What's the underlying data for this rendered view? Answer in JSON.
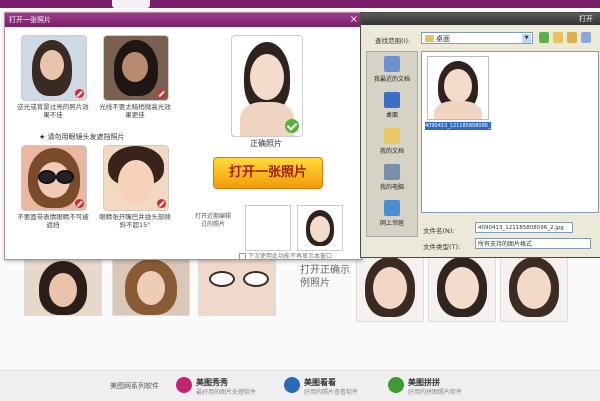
{
  "app": {
    "open_dialog_title": "打开一张照片",
    "file_dialog_title": "打开"
  },
  "samples": [
    {
      "caption": "逆光或背景过亮的照片效果不佳",
      "icon": "cross-icon"
    },
    {
      "caption": "光线不要太暗稍微高光效果更佳",
      "icon": "cross-icon"
    },
    {
      "caption": "不要面带表情眼睛不可被遮挡",
      "icon": "cross-icon"
    },
    {
      "caption": "眼睛张开嘴巴并拢头部倾斜不超15°",
      "icon": "cross-icon"
    }
  ],
  "hint": "★ 请勿用眼镜头发遮挡照片",
  "correct": {
    "label": "正确照片",
    "icon": "check-icon"
  },
  "open_button": "打开一张照片",
  "recent": {
    "label": "打开近期编辑过的照片",
    "dont_show": "下次使用此功能不再显示本窗口"
  },
  "file_dialog": {
    "look_in_label": "查找范围(I):",
    "look_in_value": "桌面",
    "places": [
      "我最近的文档",
      "桌面",
      "我的文档",
      "我的电脑",
      "网上邻居"
    ],
    "file_name_label": "文件名(N):",
    "file_name_value": "4090413_121185808096_2.jpg",
    "file_type_label": "文件类型(T):",
    "file_type_value": "所有支持的图片格式",
    "thumb_label": "4090413_121185808096_2.jpg"
  },
  "background": {
    "correct_text": "打开正确示例照片"
  },
  "bottom_bar": {
    "series_label": "美图网系列软件",
    "items": [
      {
        "title": "美图秀秀",
        "desc": "最好用的图片处理软件",
        "color": "#c0266f"
      },
      {
        "title": "美图看看",
        "desc": "好用的照片查看软件",
        "color": "#2b6ab7"
      },
      {
        "title": "美图拼拼",
        "desc": "好用的拼图照片软件",
        "color": "#3d9b35"
      }
    ]
  },
  "colors": {
    "brand": "#7a1f6b",
    "button_gradient_top": "#ffdb3a",
    "button_gradient_bottom": "#f29a0a",
    "selected": "#316ac5"
  }
}
